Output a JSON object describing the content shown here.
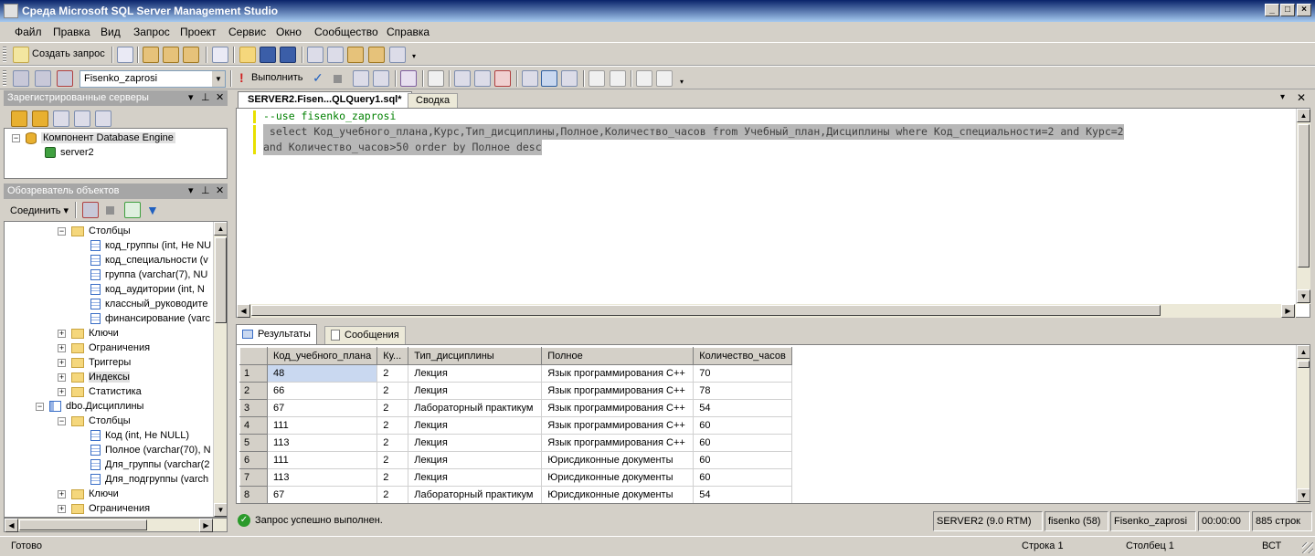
{
  "window": {
    "title": "Среда Microsoft SQL Server Management Studio"
  },
  "menu": [
    "Файл",
    "Правка",
    "Вид",
    "Запрос",
    "Проект",
    "Сервис",
    "Окно",
    "Сообщество",
    "Справка"
  ],
  "toolbar1": {
    "new_query": "Создать запрос"
  },
  "toolbar2": {
    "database": "Fisenko_zaprosi",
    "execute": "Выполнить"
  },
  "registered_servers": {
    "title": "Зарегистрированные серверы",
    "root": "Компонент Database Engine",
    "server": "server2"
  },
  "object_explorer": {
    "title": "Обозреватель объектов",
    "connect": "Соединить",
    "tree": [
      {
        "label": "Столбцы",
        "kind": "folder",
        "level": 2,
        "exp": "−"
      },
      {
        "label": "код_группы (int, Не NU",
        "kind": "column",
        "level": 3
      },
      {
        "label": "код_специальности (v",
        "kind": "column",
        "level": 3
      },
      {
        "label": "группа (varchar(7), NU",
        "kind": "column",
        "level": 3
      },
      {
        "label": "код_аудитории (int, N",
        "kind": "column",
        "level": 3
      },
      {
        "label": "классный_руководите",
        "kind": "column",
        "level": 3
      },
      {
        "label": "финансирование (varc",
        "kind": "column",
        "level": 3
      },
      {
        "label": "Ключи",
        "kind": "folder",
        "level": 2,
        "exp": "+"
      },
      {
        "label": "Ограничения",
        "kind": "folder",
        "level": 2,
        "exp": "+"
      },
      {
        "label": "Триггеры",
        "kind": "folder",
        "level": 2,
        "exp": "+"
      },
      {
        "label": "Индексы",
        "kind": "folder",
        "level": 2,
        "exp": "+"
      },
      {
        "label": "Статистика",
        "kind": "folder",
        "level": 2,
        "exp": "+"
      },
      {
        "label": "dbo.Дисциплины",
        "kind": "table",
        "level": 1,
        "exp": "−"
      },
      {
        "label": "Столбцы",
        "kind": "folder",
        "level": 2,
        "exp": "−"
      },
      {
        "label": "Код (int, Не NULL)",
        "kind": "column",
        "level": 3
      },
      {
        "label": "Полное (varchar(70), N",
        "kind": "column",
        "level": 3
      },
      {
        "label": "Для_группы (varchar(2",
        "kind": "column",
        "level": 3
      },
      {
        "label": "Для_подгруппы (varch",
        "kind": "column",
        "level": 3
      },
      {
        "label": "Ключи",
        "kind": "folder",
        "level": 2,
        "exp": "+"
      },
      {
        "label": "Ограничения",
        "kind": "folder",
        "level": 2,
        "exp": "+"
      }
    ]
  },
  "tabs": {
    "query": "SERVER2.Fisen...QLQuery1.sql*",
    "summary": "Сводка"
  },
  "code": {
    "line1": "--use fisenko_zaprosi",
    "line2": " select Код_учебного_плана,Курс,Тип_дисциплины,Полное,Количество_часов from Учебный_план,Дисциплины where Код_специальности=2 and Курс=2",
    "line3": "and Количество_часов>50 order by Полное desc"
  },
  "result_tabs": {
    "results": "Результаты",
    "messages": "Сообщения"
  },
  "grid": {
    "columns": [
      "Код_учебного_плана",
      "Ку...",
      "Тип_дисциплины",
      "Полное",
      "Количество_часов"
    ],
    "rows": [
      [
        "1",
        "48",
        "2",
        "Лекция",
        "Язык программирования С++",
        "70"
      ],
      [
        "2",
        "66",
        "2",
        "Лекция",
        "Язык программирования С++",
        "78"
      ],
      [
        "3",
        "67",
        "2",
        "Лабораторный практикум",
        "Язык программирования С++",
        "54"
      ],
      [
        "4",
        "111",
        "2",
        "Лекция",
        "Язык программирования С++",
        "60"
      ],
      [
        "5",
        "113",
        "2",
        "Лекция",
        "Язык программирования С++",
        "60"
      ],
      [
        "6",
        "111",
        "2",
        "Лекция",
        "Юрисдиконные документы",
        "60"
      ],
      [
        "7",
        "113",
        "2",
        "Лекция",
        "Юрисдиконные документы",
        "60"
      ],
      [
        "8",
        "67",
        "2",
        "Лабораторный практикум",
        "Юрисдиконные документы",
        "54"
      ]
    ]
  },
  "query_status": {
    "message": "Запрос успешно выполнен.",
    "server": "SERVER2 (9.0 RTM)",
    "user": "fisenko (58)",
    "database": "Fisenko_zaprosi",
    "time": "00:00:00",
    "rows": "885 строк"
  },
  "statusbar": {
    "ready": "Готово",
    "line": "Строка 1",
    "col": "Столбец 1",
    "ins": "ВСТ"
  },
  "colors": {
    "title_start": "#0a246a",
    "title_end": "#a6caf0",
    "comment": "#008000",
    "keyword": "#0000ff",
    "selection": "#b7b7b7",
    "success": "#2a9a2a"
  }
}
